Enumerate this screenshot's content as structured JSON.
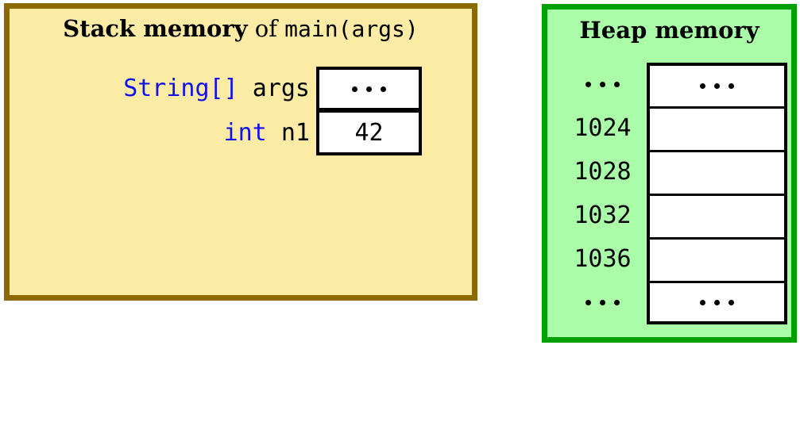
{
  "stack": {
    "title": {
      "bold": "Stack memory",
      "plain": " of ",
      "mono": "main(args)"
    },
    "variables": [
      {
        "type": "String[]",
        "name": "args",
        "value": "···",
        "value_is_dots": true
      },
      {
        "type": "int",
        "name": "n1",
        "value": "42",
        "value_is_dots": false
      }
    ],
    "background_color": "#fceba4",
    "border_color": "#8c6a03",
    "type_color": "#1111ee"
  },
  "heap": {
    "title": "Heap memory",
    "rows": [
      {
        "address": "···",
        "address_is_dots": true,
        "value": "···",
        "value_is_dots": true
      },
      {
        "address": "1024",
        "address_is_dots": false,
        "value": "",
        "value_is_dots": false
      },
      {
        "address": "1028",
        "address_is_dots": false,
        "value": "",
        "value_is_dots": false
      },
      {
        "address": "1032",
        "address_is_dots": false,
        "value": "",
        "value_is_dots": false
      },
      {
        "address": "1036",
        "address_is_dots": false,
        "value": "",
        "value_is_dots": false
      },
      {
        "address": "···",
        "address_is_dots": true,
        "value": "···",
        "value_is_dots": true
      }
    ],
    "background_color": "#aafca8",
    "border_color": "#00a000"
  }
}
